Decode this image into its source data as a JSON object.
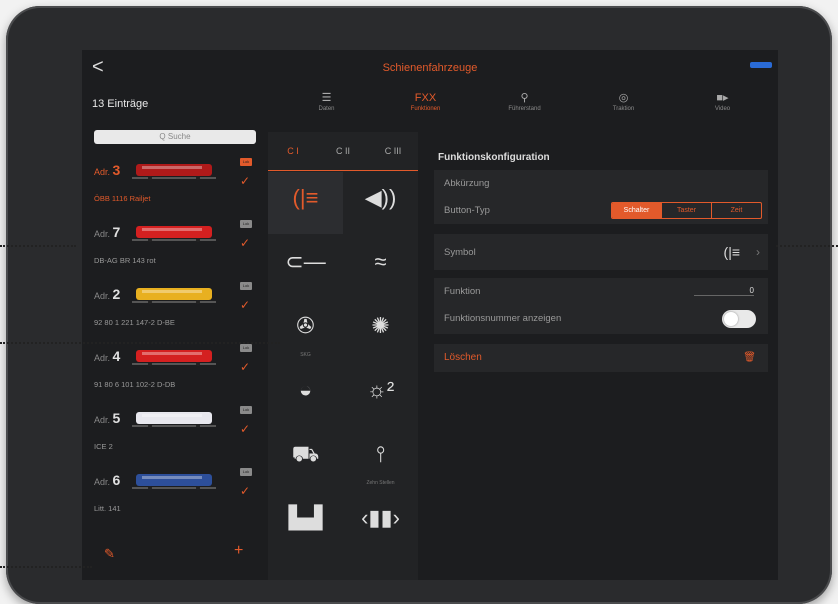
{
  "navbar": {
    "back_label": "<",
    "title": "Schienenfahrzeuge"
  },
  "list_header": {
    "count": "13 Einträge"
  },
  "tabs": [
    {
      "icon": "☰",
      "label": "Daten",
      "active": false
    },
    {
      "icon": "FXX",
      "label": "Funktionen",
      "active": true
    },
    {
      "icon": "⚲",
      "label": "Führerstand",
      "active": false
    },
    {
      "icon": "◎",
      "label": "Traktion",
      "active": false
    },
    {
      "icon": "■▸",
      "label": "Video",
      "active": false
    }
  ],
  "search": {
    "placeholder": "Q Suche"
  },
  "locos": [
    {
      "adr_prefix": "Adr.",
      "adr": "3",
      "name": "ÖBB 1116 Railjet",
      "badge": "Lok",
      "selected": true,
      "color": "#b01a1a"
    },
    {
      "adr_prefix": "Adr.",
      "adr": "7",
      "name": "DB-AG BR 143 rot",
      "badge": "Lok",
      "selected": false,
      "color": "#d42020"
    },
    {
      "adr_prefix": "Adr.",
      "adr": "2",
      "name": "92 80 1 221 147-2 D-BE",
      "badge": "Lok",
      "selected": false,
      "color": "#e8b020"
    },
    {
      "adr_prefix": "Adr.",
      "adr": "4",
      "name": "91 80 6 101 102-2 D-DB",
      "badge": "Lok",
      "selected": false,
      "color": "#d42020"
    },
    {
      "adr_prefix": "Adr.",
      "adr": "5",
      "name": "ICE 2",
      "badge": "Lok",
      "selected": false,
      "color": "#e8e8ee"
    },
    {
      "adr_prefix": "Adr.",
      "adr": "6",
      "name": "Litt. 141",
      "badge": "Lok",
      "selected": false,
      "color": "#2d4f9a"
    }
  ],
  "list_footer": {
    "edit_icon": "pencil-icon",
    "add_label": "+"
  },
  "function_tabs": [
    "C I",
    "C II",
    "C III"
  ],
  "function_icons": [
    {
      "name": "headlight",
      "glyph": "(|≡",
      "caption": ""
    },
    {
      "name": "sound",
      "glyph": "◀))",
      "caption": ""
    },
    {
      "name": "horn",
      "glyph": "⊂—",
      "caption": ""
    },
    {
      "name": "curve-sound",
      "glyph": "≈",
      "caption": ""
    },
    {
      "name": "fan",
      "glyph": "✇",
      "caption": "SKG"
    },
    {
      "name": "brake-sound",
      "glyph": "✺",
      "caption": ""
    },
    {
      "name": "conductor-cap",
      "glyph": "◒",
      "caption": ""
    },
    {
      "name": "interior-light",
      "glyph": "☼²",
      "caption": ""
    },
    {
      "name": "car",
      "glyph": "⛟",
      "caption": ""
    },
    {
      "name": "signal",
      "glyph": "⫯",
      "caption": "Zehn Stellen"
    },
    {
      "name": "door",
      "glyph": "▙▟",
      "caption": ""
    },
    {
      "name": "door-sound",
      "glyph": "‹▮▮›",
      "caption": ""
    }
  ],
  "config": {
    "title": "Funktionskonfiguration",
    "abbrev_label": "Abkürzung",
    "button_type_label": "Button-Typ",
    "button_types": [
      "Schalter",
      "Taster",
      "Zeit"
    ],
    "symbol_label": "Symbol",
    "symbol_glyph": "(|≡",
    "function_label": "Funktion",
    "function_value": "0",
    "show_number_label": "Funktionsnummer anzeigen",
    "delete_label": "Löschen",
    "delete_icon": "🗑"
  },
  "colors": {
    "accent": "#e25a2b",
    "background": "#1c1d1f"
  }
}
